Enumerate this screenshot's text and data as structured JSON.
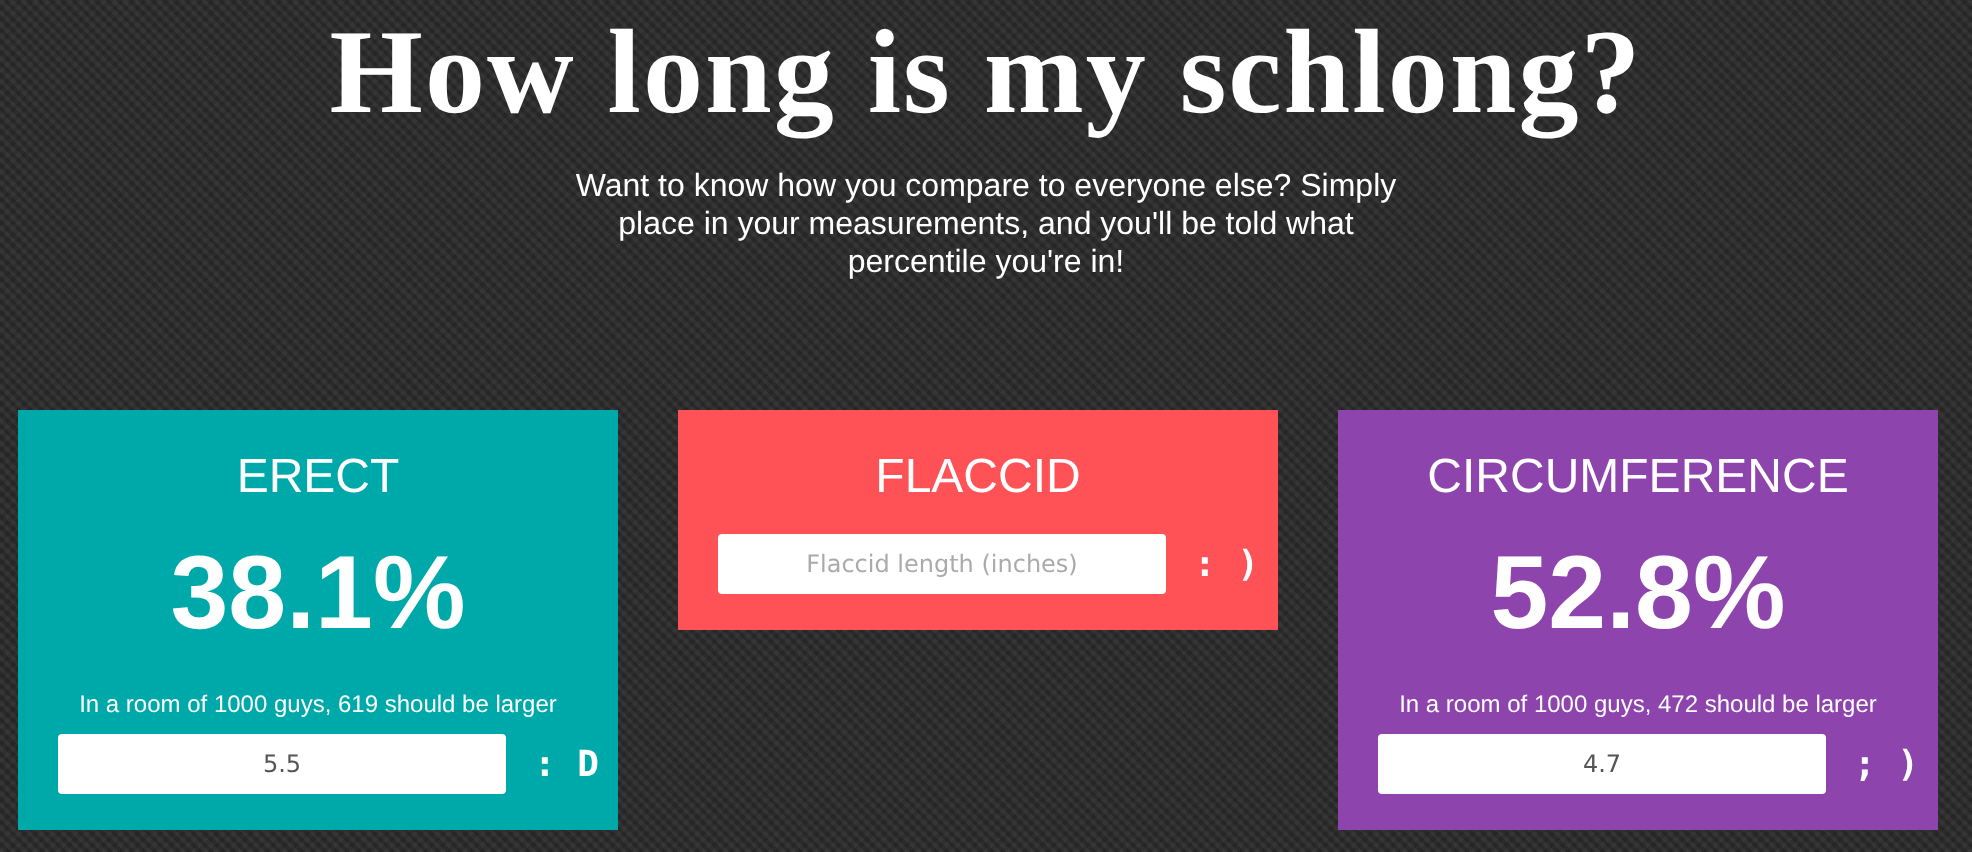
{
  "header": {
    "title": "How long is my schlong?",
    "subtitle": "Want to know how you compare to everyone else? Simply place in your measurements, and you'll be told what percentile you're in!"
  },
  "cards": [
    {
      "title": "ERECT",
      "color": "#00a9a9",
      "percent": "38.1%",
      "caption": "In a room of 1000 guys, 619 should be larger",
      "input": {
        "value": "5.5"
      },
      "emoticon": ": D"
    },
    {
      "title": "FLACCID",
      "color": "#ff5257",
      "input": {
        "placeholder": "Flaccid length (inches)"
      },
      "emoticon": ": )"
    },
    {
      "title": "CIRCUMFERENCE",
      "color": "#8e44ad",
      "percent": "52.8%",
      "caption": "In a room of 1000 guys, 472 should be larger",
      "input": {
        "value": "4.7"
      },
      "emoticon": "; )"
    }
  ]
}
